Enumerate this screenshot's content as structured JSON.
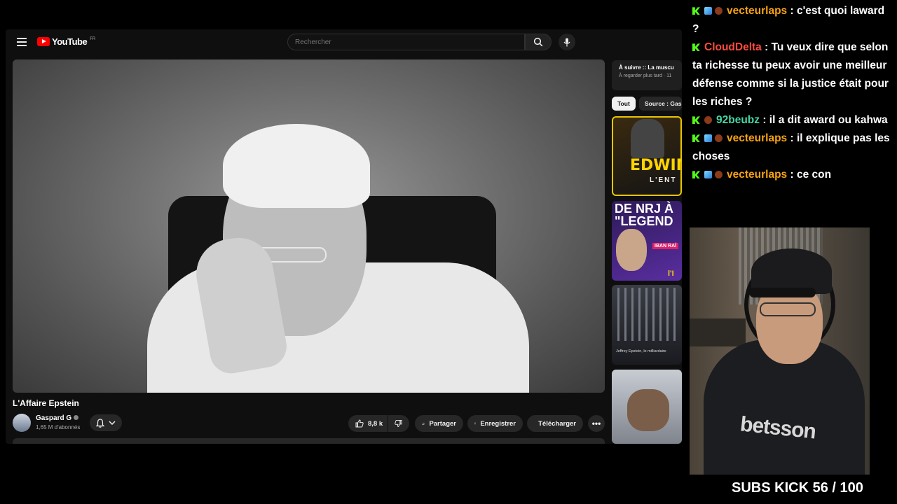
{
  "youtube": {
    "logo_text": "YouTube",
    "region": "FR",
    "search_placeholder": "Rechercher",
    "video": {
      "title": "L'Affaire Epstein",
      "channel": "Gaspard G",
      "subscribers": "1,65 M d'abonnés",
      "likes": "8,8 k",
      "share_label": "Partager",
      "save_label": "Enregistrer",
      "download_label": "Télécharger"
    },
    "up_next": {
      "title": "À suivre :: La muscu",
      "subtitle": "À regarder plus tard · 11"
    },
    "chips": [
      "Tout",
      "Source : Gas"
    ],
    "thumbnails": [
      {
        "text": "EDWIN",
        "subtext": "L'ENT"
      },
      {
        "text": "DE NRJ À\n\"LEGEND",
        "tag": "IBAN RAÏ",
        "corner": "l'I"
      },
      {
        "text": "Jeffrey Epstein, le milliardaire"
      },
      {
        "text": ""
      }
    ]
  },
  "chat": [
    {
      "user": "vecteurlaps",
      "text": ": c'est quoi laward ?",
      "color": "#f6a313",
      "badges": [
        "kick",
        "cube",
        "ball"
      ]
    },
    {
      "user": "CloudDelta",
      "text": ": Tu veux dire que selon ta richesse tu peux avoir une meilleur défense comme si la justice était pour les riches ?",
      "color": "#ff4b3e",
      "badges": [
        "kick"
      ]
    },
    {
      "user": "92beubz",
      "text": ": il a dit award ou kahwa",
      "color": "#45d6a6",
      "badges": [
        "kick",
        "ball"
      ]
    },
    {
      "user": "vecteurlaps",
      "text": ": il explique pas les choses",
      "color": "#f6a313",
      "badges": [
        "kick",
        "cube",
        "ball"
      ]
    },
    {
      "user": "vecteurlaps",
      "text": ": ce con",
      "color": "#f6a313",
      "badges": [
        "kick",
        "cube",
        "ball"
      ]
    }
  ],
  "webcam": {
    "shirt_text": "betsson"
  },
  "subs_goal": "SUBS KICK 56 / 100"
}
